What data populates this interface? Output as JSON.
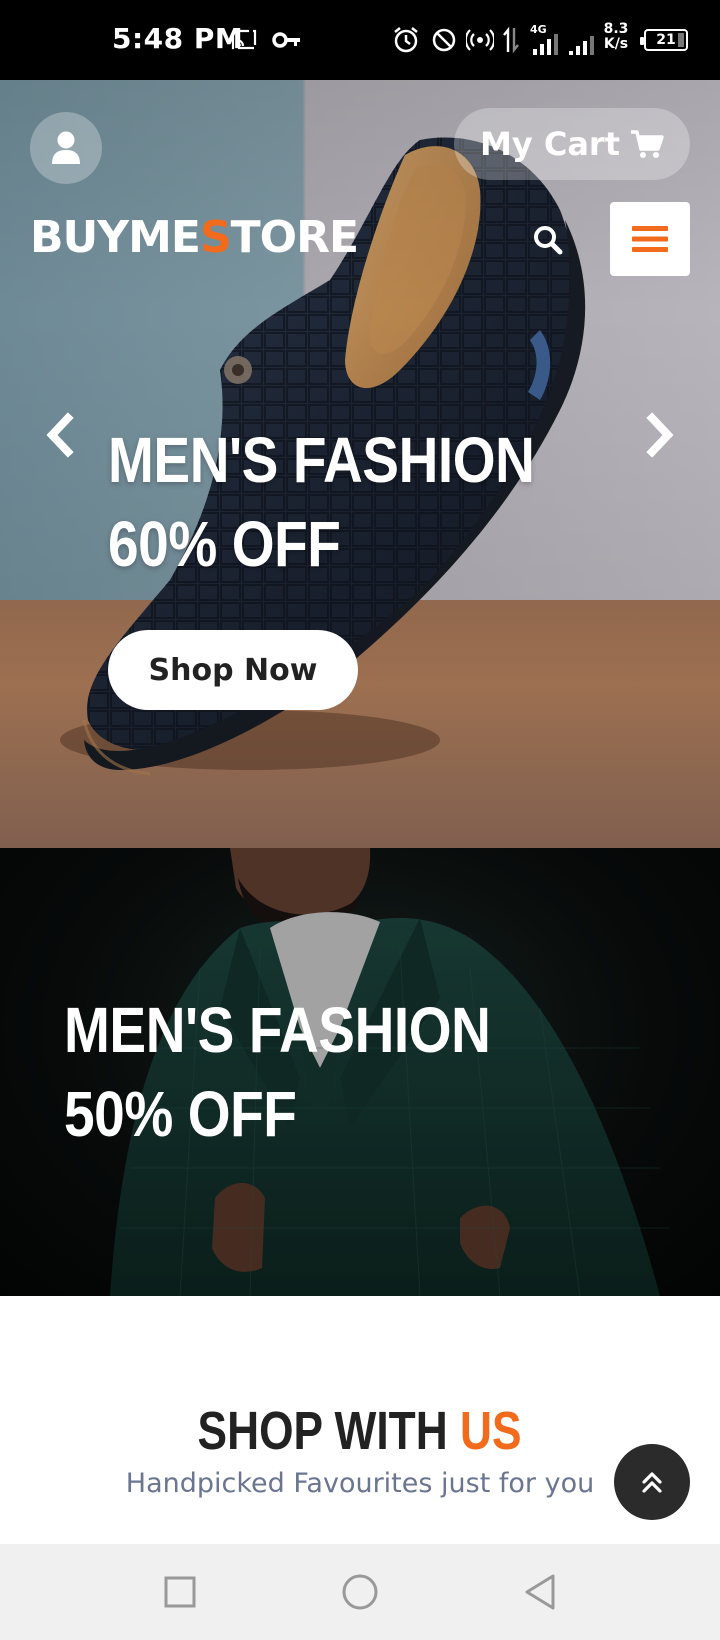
{
  "status_bar": {
    "time": "5:48 PM",
    "network_type": "4G",
    "speed_value": "8.3",
    "speed_unit": "K/s",
    "battery": "21",
    "icons": [
      "screencast-icon",
      "key-icon",
      "alarm-icon",
      "do-not-disturb-icon",
      "hotspot-icon",
      "data-transfer-icon",
      "signal-icon",
      "signal-icon-2",
      "battery-icon"
    ]
  },
  "header": {
    "cart_label": "My Cart",
    "logo_part1": "BUYME",
    "logo_accent": "S",
    "logo_part2": "TORE"
  },
  "hero": {
    "line1": "MEN'S FASHION",
    "line2": "60% OFF",
    "cta": "Shop Now"
  },
  "promo": {
    "line1": "MEN'S FASHION",
    "line2": "50% OFF"
  },
  "section": {
    "title_main": "SHOP WITH ",
    "title_accent": "US",
    "subtitle": "Handpicked Favourites just for you"
  },
  "colors": {
    "accent": "#f26a1b",
    "dark": "#222222",
    "subtitle": "#6a7590"
  },
  "nav": {
    "icons": [
      "recent-apps-icon",
      "home-icon",
      "back-icon"
    ]
  }
}
